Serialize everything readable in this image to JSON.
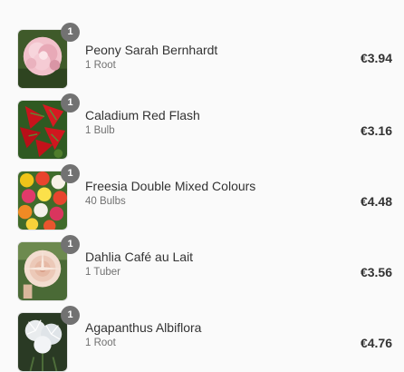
{
  "colors": {
    "badge": "#727272",
    "text": "#333333",
    "muted": "#717171",
    "background": "#fafafa"
  },
  "cart": {
    "items": [
      {
        "name": "Peony Sarah Bernhardt",
        "variant": "1 Root",
        "price": "€3.94",
        "quantity": "1",
        "image": "pink-peony-image"
      },
      {
        "name": "Caladium Red Flash",
        "variant": "1 Bulb",
        "price": "€3.16",
        "quantity": "1",
        "image": "red-caladium-image"
      },
      {
        "name": "Freesia Double Mixed Colours",
        "variant": "40 Bulbs",
        "price": "€4.48",
        "quantity": "1",
        "image": "mixed-freesia-image"
      },
      {
        "name": "Dahlia Café au Lait",
        "variant": "1 Tuber",
        "price": "€3.56",
        "quantity": "1",
        "image": "cafe-au-lait-dahlia-image"
      },
      {
        "name": "Agapanthus Albiflora",
        "variant": "1 Root",
        "price": "€4.76",
        "quantity": "1",
        "image": "white-agapanthus-image"
      }
    ]
  }
}
